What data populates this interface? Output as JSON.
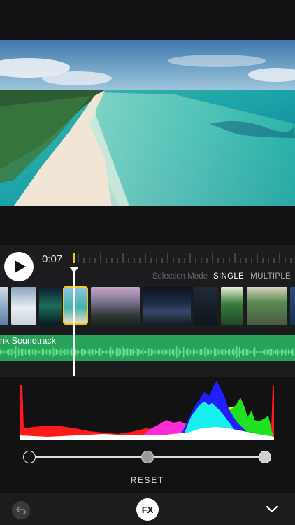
{
  "player": {
    "current_time": "0:07",
    "play_icon": "play-icon"
  },
  "selection_mode": {
    "label": "Selection Mode",
    "options": [
      "SINGLE",
      "MULTIPLE"
    ],
    "selected": "SINGLE"
  },
  "filmstrip": {
    "selected_index": 4,
    "count": 11
  },
  "soundtrack": {
    "label": "nk Soundtrack",
    "color": "#2aa35a"
  },
  "levels": {
    "black_point": 0.0,
    "midtone": 0.5,
    "white_point": 1.0,
    "reset_label": "RESET"
  },
  "toolbar": {
    "fx_label": "FX",
    "undo_icon": "undo-icon",
    "collapse_icon": "chevron-down-icon"
  },
  "colors": {
    "accent": "#f5c518",
    "audio_green": "#2aa35a",
    "background": "#121212"
  }
}
